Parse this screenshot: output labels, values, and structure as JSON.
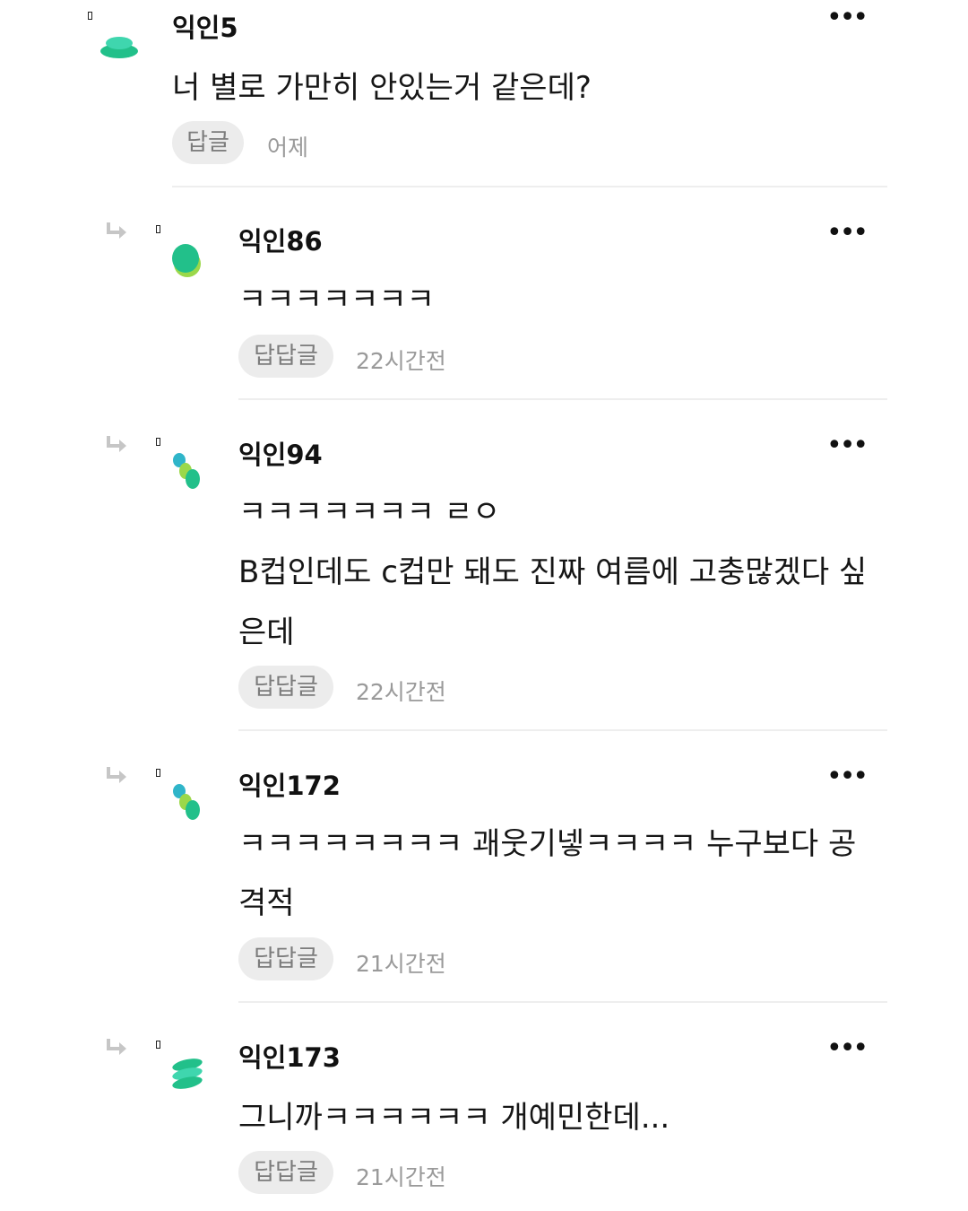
{
  "comments": [
    {
      "name": "익인5",
      "lines": [
        "너 별로 가만히 안있는거 같은데?"
      ],
      "reply_label": "답글",
      "time": "어제"
    },
    {
      "name": "익인86",
      "lines": [
        "ㅋㅋㅋㅋㅋㅋㅋ"
      ],
      "reply_label": "답답글",
      "time": "22시간전"
    },
    {
      "name": "익인94",
      "lines": [
        "ㅋㅋㅋㅋㅋㅋㅋ ㄹㅇ",
        "B컵인데도 c컵만 돼도 진짜 여름에 고충많겠다 싶",
        "은데"
      ],
      "reply_label": "답답글",
      "time": "22시간전"
    },
    {
      "name": "익인172",
      "lines": [
        "ㅋㅋㅋㅋㅋㅋㅋㅋ 괘웃기넿ㅋㅋㅋㅋ 누구보다 공",
        "격적"
      ],
      "reply_label": "답답글",
      "time": "21시간전"
    },
    {
      "name": "익인173",
      "lines": [
        "그니까ㅋㅋㅋㅋㅋㅋ 개예민한데..."
      ],
      "reply_label": "답답글",
      "time": "21시간전"
    }
  ],
  "colors": {
    "avatar_green": "#22c08a",
    "avatar_mint": "#3fd6ae",
    "avatar_lime": "#9bd84a",
    "avatar_teal": "#2fb5c9",
    "pill_bg": "#ececec"
  },
  "icons": {
    "more": "more-dots-icon",
    "reply_arrow": "reply-arrow-icon"
  }
}
